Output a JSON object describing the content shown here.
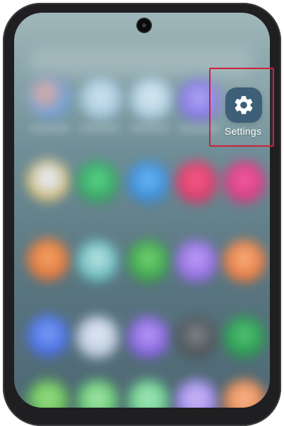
{
  "settings_app": {
    "label": "Settings",
    "icon": "gear-icon"
  },
  "colors": {
    "highlight": "#d01f3a",
    "settings_icon_bg": "#3d5f78"
  }
}
